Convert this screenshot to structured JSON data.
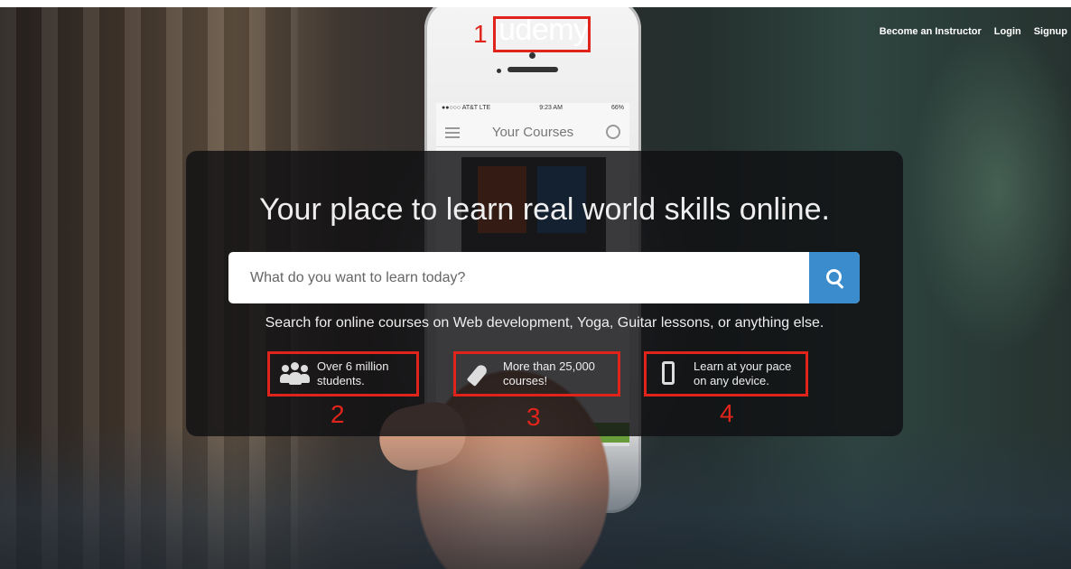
{
  "brand": {
    "logo_text": "udemy"
  },
  "nav": {
    "items": [
      "Become an Instructor",
      "Login",
      "Signup"
    ]
  },
  "hero": {
    "headline": "Your place to learn real world skills online.",
    "search_placeholder": "What do you want to learn today?",
    "search_value": "",
    "subtext": "Search for online courses on Web development, Yoga, Guitar lessons, or anything else."
  },
  "features": [
    {
      "icon": "people-icon",
      "line1": "Over 6 million",
      "line2": "students."
    },
    {
      "icon": "rocket-icon",
      "line1": "More than 25,000",
      "line2": "courses!"
    },
    {
      "icon": "mobile-device-icon",
      "line1": "Learn at your pace",
      "line2": "on any device."
    }
  ],
  "annotations": [
    "1",
    "2",
    "3",
    "4"
  ],
  "phone_screen": {
    "status_left": "●●○○○ AT&T LTE",
    "status_time": "9:23 AM",
    "status_right": "66%",
    "app_title": "Your Courses"
  },
  "colors": {
    "accent": "#3b8ccc",
    "annotation_red": "#e0241b",
    "panel": "#101012"
  }
}
